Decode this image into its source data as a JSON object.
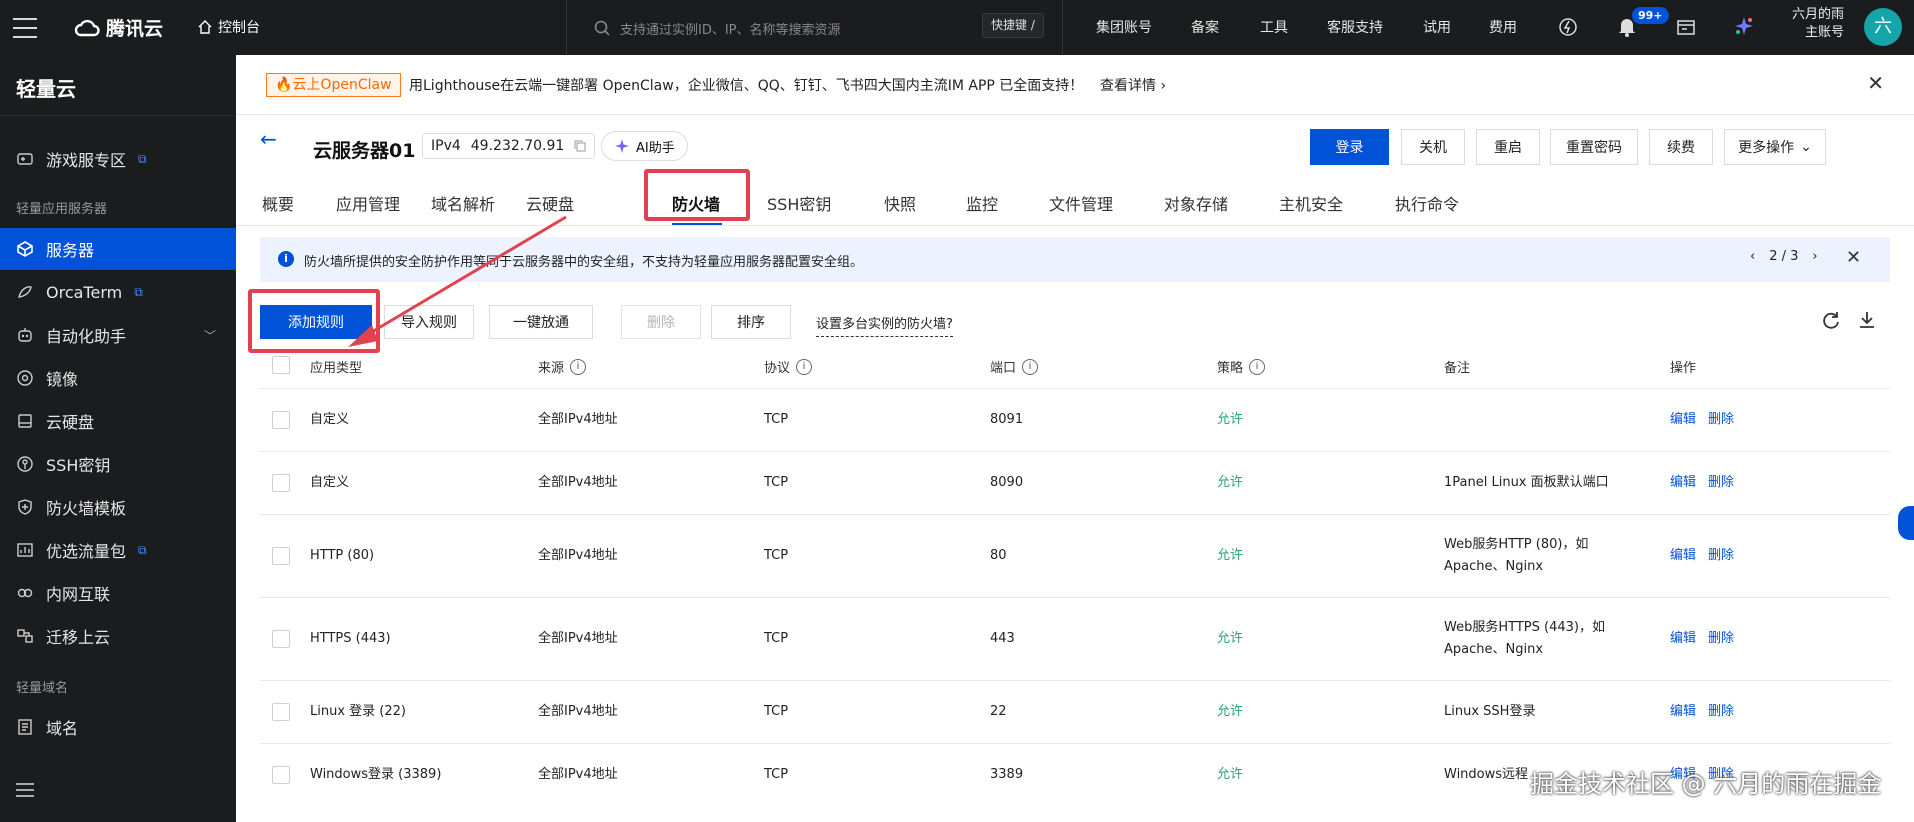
{
  "topbar": {
    "brand": "腾讯云",
    "console": "控制台",
    "search_placeholder": "支持通过实例ID、IP、名称等搜索资源",
    "shortcut": "快捷键 /",
    "links": [
      "集团账号",
      "备案",
      "工具",
      "客服支持",
      "试用",
      "费用"
    ],
    "notif_count": "99+",
    "user_name": "六月的雨",
    "user_role": "主账号",
    "avatar_char": "六"
  },
  "sidebar": {
    "title": "轻量云",
    "group1": "轻量应用服务器",
    "group2": "轻量域名",
    "items": [
      {
        "label": "游戏服专区",
        "icon": "game-icon"
      },
      {
        "label": "服务器",
        "icon": "server-icon"
      },
      {
        "label": "OrcaTerm",
        "icon": "terminal-icon"
      },
      {
        "label": "自动化助手",
        "icon": "automation-icon"
      },
      {
        "label": "镜像",
        "icon": "image-icon"
      },
      {
        "label": "云硬盘",
        "icon": "disk-icon"
      },
      {
        "label": "SSH密钥",
        "icon": "key-icon"
      },
      {
        "label": "防火墙模板",
        "icon": "shield-icon"
      },
      {
        "label": "优选流量包",
        "icon": "traffic-icon"
      },
      {
        "label": "内网互联",
        "icon": "network-icon"
      },
      {
        "label": "迁移上云",
        "icon": "migrate-icon"
      },
      {
        "label": "域名",
        "icon": "domain-icon"
      }
    ]
  },
  "notice": {
    "tag": "云上OpenClaw",
    "text": "用Lighthouse在云端一键部署 OpenClaw，企业微信、QQ、钉钉、飞书四大国内主流IM APP 已全面支持！",
    "link": "查看详情"
  },
  "server": {
    "name": "云服务器01",
    "ip_type": "IPv4",
    "ip": "49.232.70.91",
    "ai_label": "AI助手"
  },
  "actions": [
    "登录",
    "关机",
    "重启",
    "重置密码",
    "续费",
    "更多操作"
  ],
  "tabs": [
    "概要",
    "应用管理",
    "域名解析",
    "云硬盘",
    "防火墙",
    "SSH密钥",
    "快照",
    "监控",
    "文件管理",
    "对象存储",
    "主机安全",
    "执行命令"
  ],
  "info": {
    "text": "防火墙所提供的安全防护作用等同于云服务器中的安全组，不支持为轻量应用服务器配置安全组。",
    "pager": "2 / 3"
  },
  "toolbar": {
    "add": "添加规则",
    "import": "导入规则",
    "allow_all": "一键放通",
    "delete": "删除",
    "sort": "排序",
    "multi": "设置多台实例的防火墙?"
  },
  "table": {
    "headers": [
      "应用类型",
      "来源",
      "协议",
      "端口",
      "策略",
      "备注",
      "操作"
    ],
    "rows": [
      {
        "type": "自定义",
        "source": "全部IPv4地址",
        "protocol": "TCP",
        "port": "8091",
        "policy": "允许",
        "note": "",
        "note2": ""
      },
      {
        "type": "自定义",
        "source": "全部IPv4地址",
        "protocol": "TCP",
        "port": "8090",
        "policy": "允许",
        "note": "1Panel Linux 面板默认端口",
        "note2": ""
      },
      {
        "type": "HTTP (80)",
        "source": "全部IPv4地址",
        "protocol": "TCP",
        "port": "80",
        "policy": "允许",
        "note": "Web服务HTTP (80)，如",
        "note2": "Apache、Nginx"
      },
      {
        "type": "HTTPS (443)",
        "source": "全部IPv4地址",
        "protocol": "TCP",
        "port": "443",
        "policy": "允许",
        "note": "Web服务HTTPS (443)，如",
        "note2": "Apache、Nginx"
      },
      {
        "type": "Linux 登录 (22)",
        "source": "全部IPv4地址",
        "protocol": "TCP",
        "port": "22",
        "policy": "允许",
        "note": "Linux SSH登录",
        "note2": ""
      },
      {
        "type": "Windows登录 (3389)",
        "source": "全部IPv4地址",
        "protocol": "TCP",
        "port": "3389",
        "policy": "允许",
        "note": "Windows远程",
        "note2": ""
      }
    ],
    "edit": "编辑",
    "delete": "删除"
  },
  "watermark": "掘金技术社区 @ 六月的雨在掘金",
  "colors": {
    "primary": "#0052d9",
    "allow": "#2ba471",
    "highlight": "#e2424f",
    "dark": "#1b1c1e"
  }
}
